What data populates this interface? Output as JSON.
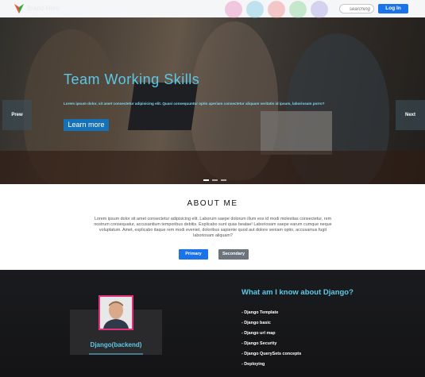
{
  "nav": {
    "logo_text": "Brand Here",
    "search_placeholder": "searching",
    "login_label": "Log In",
    "circle_colors": [
      "#e86fb0",
      "#5bc0de",
      "#f0716e",
      "#6ccf7a",
      "#9b8fe0"
    ]
  },
  "hero": {
    "title": "Team Working Skills",
    "text": "Lorem ipsum dolor, sit amet consectetur adipisicing elit. Quasi consequuntur optio aperiam consectetur aliquam veritatis id ipsum, laboriosam porro?",
    "learn_more": "Learn more",
    "prev": "Prew",
    "next": "Next"
  },
  "about": {
    "title": "ABOUT ME",
    "text": "Lorem ipsum dolor sit amet consectetur adipisicing elit. Laborum saepe dolorum illum eos id modi molestias consectetur, rem nostrum consequatur, accusantium temporibus debitis. Explicabo sunt quas beatae! Laboriosam saepe earum cumque neque voluptatum. Amet, explicabo itaque rem modi eveniet, doloribus sapiente quod aut dolore veniam optio, accusamus fugit laboriosam aliquam?",
    "primary": "Primary",
    "secondary": "Secondary"
  },
  "django": {
    "name": "Django(backend)",
    "heading": "What am I know about Django?",
    "items": [
      "- Django Template",
      "- Django basic",
      "- Django url map",
      "- Django Security",
      "- Django QuerySets concepts",
      "- Deploying"
    ]
  }
}
